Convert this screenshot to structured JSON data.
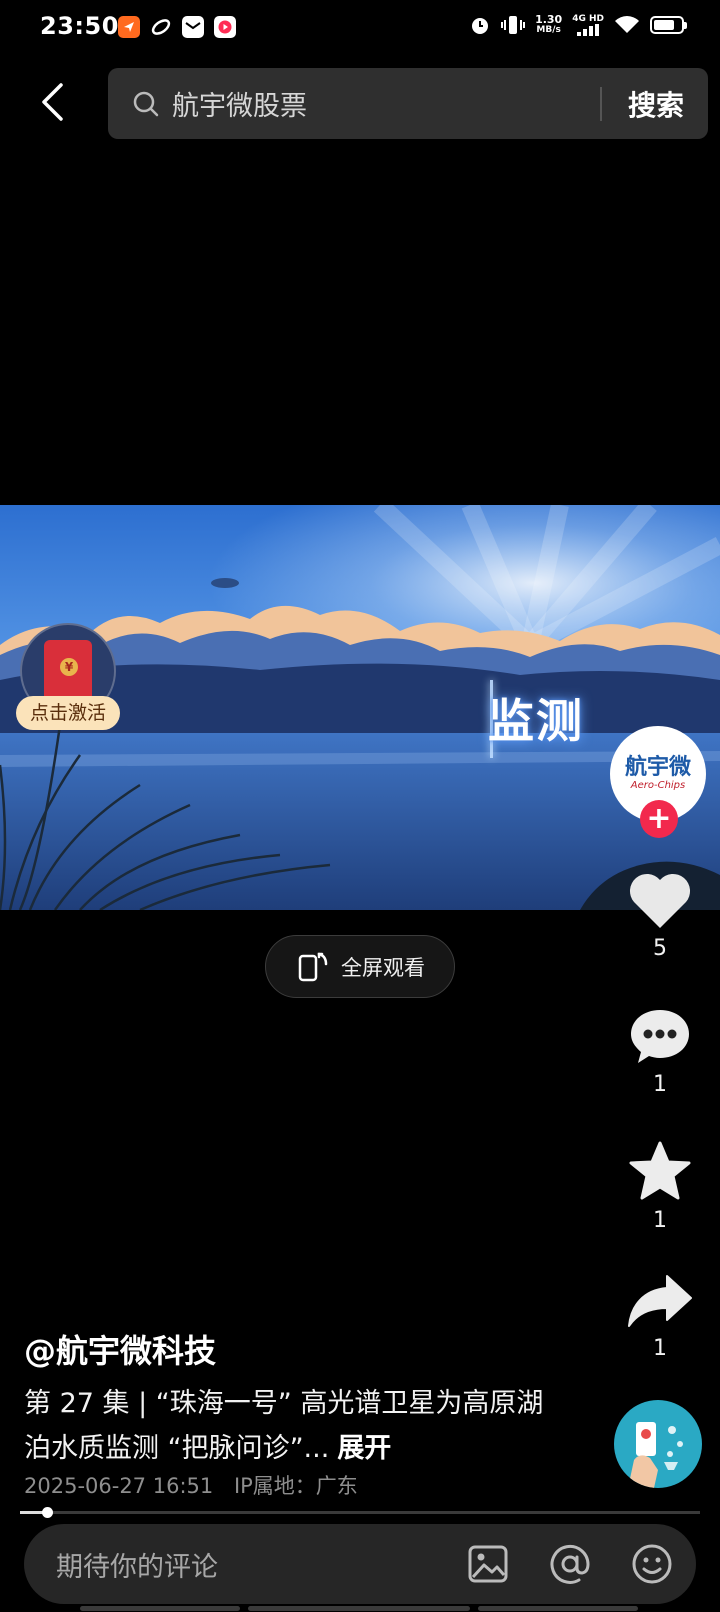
{
  "status_bar": {
    "time": "23:50",
    "net_speed_value": "1.30",
    "net_speed_unit": "MB/s",
    "network_type": "4G HD",
    "battery_level": 0.75,
    "app_icons": [
      "task-app-icon",
      "infinity-app-icon",
      "mail-app-icon",
      "video-app-icon"
    ],
    "colors": {
      "task": "#ff6a1f",
      "infinity": "#ffffff",
      "mail": "#ffffff",
      "video": "#ff2d55"
    }
  },
  "search": {
    "query": "航宇微股票",
    "button_label": "搜索"
  },
  "video": {
    "caption_overlay": "监测"
  },
  "red_packet": {
    "label": "点击激活"
  },
  "fullscreen": {
    "label": "全屏观看"
  },
  "author_avatar": {
    "name_cn": "航宇微",
    "name_en": "Aero-Chips",
    "follow_symbol": "+"
  },
  "actions": {
    "like_count": "5",
    "comment_count": "1",
    "favorite_count": "1",
    "share_count": "1"
  },
  "post": {
    "author": "@航宇微科技",
    "description": "第 27 集 | “珠海一号” 高光谱卫星为高原湖泊水质监测 “把脉问诊”...",
    "expand_label": "展开",
    "date": "2025-06-27 16:51",
    "ip_location": "IP属地：广东"
  },
  "playback": {
    "progress": 0.04
  },
  "comment_bar": {
    "placeholder": "期待你的评论"
  },
  "accent_colors": {
    "follow": "#f2294d",
    "brand_blue": "#1e5ba8"
  }
}
